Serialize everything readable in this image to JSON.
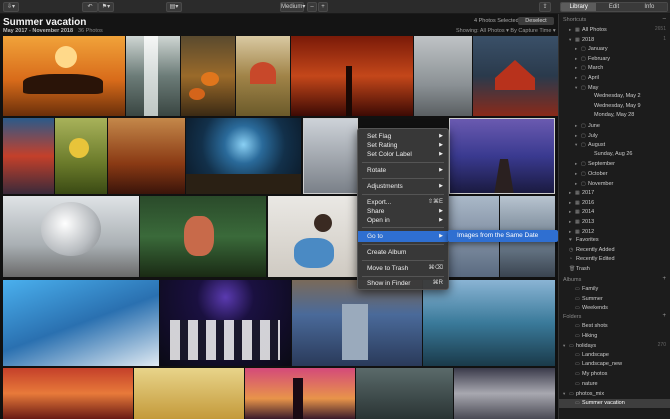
{
  "toolbar": {
    "size_label": "Medium",
    "minus": "–",
    "plus": "+"
  },
  "header": {
    "title": "Summer vacation",
    "date_range": "May 2017 - November 2018",
    "photo_count": "36 Photos",
    "selected": "4 Photos Selected",
    "deselect": "Deselect",
    "showing": "Showing: All Photos ▾    By Capture Time ▾"
  },
  "tabs": [
    "Library",
    "Edit",
    "Info"
  ],
  "menu": {
    "items": {
      "set_flag": "Set Flag",
      "set_rating": "Set Rating",
      "set_color": "Set Color Label",
      "rotate": "Rotate",
      "adjustments": "Adjustments",
      "export": "Export...",
      "export_sc": "⇧⌘E",
      "share": "Share",
      "open_in": "Open in",
      "go_to": "Go to",
      "create_album": "Create Album",
      "move_trash": "Move to Trash",
      "move_trash_sc": "⌘⌫",
      "show_finder": "Show in Finder",
      "show_finder_sc": "⌘R"
    },
    "submenu": "Images from the Same Date"
  },
  "sidebar": {
    "shortcuts_label": "Shortcuts",
    "albums_label": "Albums",
    "folders_label": "Folders",
    "shortcuts": [
      {
        "label": "All Photos",
        "count": "2651"
      },
      {
        "label": "2018",
        "count": "1"
      },
      {
        "label": "January",
        "count": ""
      },
      {
        "label": "February",
        "count": ""
      },
      {
        "label": "March",
        "count": ""
      },
      {
        "label": "April",
        "count": ""
      },
      {
        "label": "May",
        "count": ""
      },
      {
        "label": "Wednesday, May 2",
        "count": ""
      },
      {
        "label": "Wednesday, May 9",
        "count": ""
      },
      {
        "label": "Monday, May 28",
        "count": ""
      },
      {
        "label": "June",
        "count": ""
      },
      {
        "label": "July",
        "count": ""
      },
      {
        "label": "August",
        "count": ""
      },
      {
        "label": "Sunday, Aug 26",
        "count": ""
      },
      {
        "label": "September",
        "count": ""
      },
      {
        "label": "October",
        "count": ""
      },
      {
        "label": "November",
        "count": ""
      },
      {
        "label": "2017",
        "count": ""
      },
      {
        "label": "2016",
        "count": ""
      },
      {
        "label": "2014",
        "count": ""
      },
      {
        "label": "2013",
        "count": ""
      },
      {
        "label": "2012",
        "count": ""
      },
      {
        "label": "Favorites",
        "count": ""
      },
      {
        "label": "Recently Added",
        "count": ""
      },
      {
        "label": "Recently Edited",
        "count": ""
      },
      {
        "label": "Trash",
        "count": ""
      }
    ],
    "albums": [
      {
        "label": "Family",
        "count": ""
      },
      {
        "label": "Summer",
        "count": ""
      },
      {
        "label": "Weekends",
        "count": ""
      }
    ],
    "folders": [
      {
        "label": "Best shots",
        "count": ""
      },
      {
        "label": "Hiking",
        "count": ""
      },
      {
        "label": "holidays",
        "count": "270"
      },
      {
        "label": "Landscape",
        "count": ""
      },
      {
        "label": "Landscape_new",
        "count": ""
      },
      {
        "label": "My photos",
        "count": ""
      },
      {
        "label": "nature",
        "count": ""
      },
      {
        "label": "photos_mix",
        "count": ""
      },
      {
        "label": "Summer vacation",
        "count": ""
      }
    ]
  },
  "colors": {
    "accent": "#2f6fd1",
    "background": "#111111",
    "sidebar": "#1c1c1c"
  }
}
